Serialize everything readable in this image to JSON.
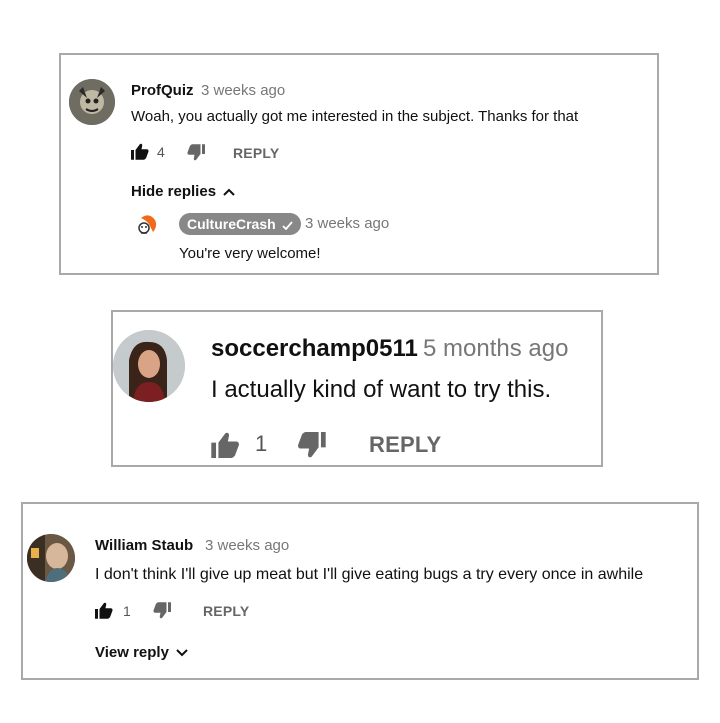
{
  "comments": [
    {
      "author": "ProfQuiz",
      "time": "3 weeks ago",
      "text": "Woah, you actually got me interested in the subject. Thanks for that",
      "likes": "4",
      "reply_label": "REPLY",
      "replies_toggle": "Hide replies",
      "replies_toggle_icon": "chevron-up-icon",
      "reply": {
        "author": "CultureCrash",
        "verified_icon": "checkmark-icon",
        "time": "3 weeks ago",
        "text": "You're very welcome!"
      }
    },
    {
      "author": "soccerchamp0511",
      "time": "5 months ago",
      "text": "I actually kind of want to try this.",
      "likes": "1",
      "reply_label": "REPLY"
    },
    {
      "author": "William Staub",
      "time": "3 weeks ago",
      "text": "I don't think I'll give up meat but I'll give eating bugs a try every once in awhile",
      "likes": "1",
      "reply_label": "REPLY",
      "replies_toggle": "View reply",
      "replies_toggle_icon": "chevron-down-icon"
    }
  ],
  "colors": {
    "border": "#a9a9a9",
    "muted_text": "#777777",
    "badge_bg": "#888888",
    "icon_dark": "#111111",
    "icon_grey": "#666666"
  }
}
